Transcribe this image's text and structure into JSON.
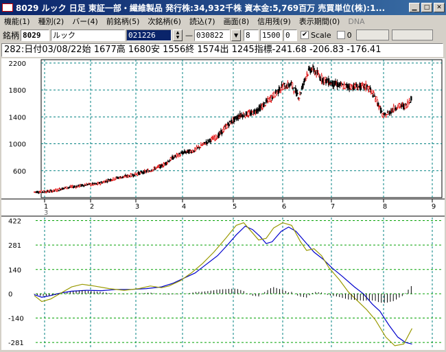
{
  "window": {
    "title": "8029 ルック  日足  東証一部・繊維製品  発行株:34,932千株  資本金:5,769百万  売買単位(株):1..."
  },
  "menu": [
    {
      "label": "機能(1)",
      "disabled": false
    },
    {
      "label": "種別(2)",
      "disabled": false
    },
    {
      "label": "バー(4)",
      "disabled": false
    },
    {
      "label": "前銘柄(5)",
      "disabled": false
    },
    {
      "label": "次銘柄(6)",
      "disabled": false
    },
    {
      "label": "読込(7)",
      "disabled": false
    },
    {
      "label": "画面(8)",
      "disabled": false
    },
    {
      "label": "信用残(9)",
      "disabled": false
    },
    {
      "label": "表示期間(0)",
      "disabled": false
    },
    {
      "label": "DNA",
      "disabled": true
    }
  ],
  "toolbar": {
    "stock_label": "銘柄",
    "code": "8029",
    "name": "ルック",
    "start_date": "021226",
    "dash": "—",
    "end_date": "030822",
    "period": "8",
    "count": "1500",
    "offset": "0",
    "scale_label": "Scale",
    "scale_checked": true,
    "scale_value": "0"
  },
  "info": {
    "text": "282:日付03/08/22始 1677高 1680安 1556終 1574出 1245指標-241.68  -206.83  -176.41"
  },
  "chart_data": [
    {
      "type": "candlestick",
      "ylim": [
        200,
        2250
      ],
      "y_ticks": [
        "2200",
        "1800",
        "1400",
        "1000",
        "600"
      ],
      "y_tick_values": [
        2200,
        1800,
        1400,
        1000,
        600
      ],
      "x_ticks": [
        "1",
        "2",
        "3",
        "4",
        "5",
        "6",
        "7",
        "8",
        "9"
      ],
      "x_sub_label": "3",
      "close_path": [
        [
          0,
          285
        ],
        [
          12,
          290
        ],
        [
          22,
          300
        ],
        [
          35,
          345
        ],
        [
          50,
          370
        ],
        [
          60,
          395
        ],
        [
          72,
          400
        ],
        [
          84,
          455
        ],
        [
          96,
          495
        ],
        [
          108,
          520
        ],
        [
          120,
          560
        ],
        [
          132,
          600
        ],
        [
          148,
          680
        ],
        [
          160,
          800
        ],
        [
          172,
          870
        ],
        [
          184,
          900
        ],
        [
          198,
          1020
        ],
        [
          212,
          1120
        ],
        [
          224,
          1300
        ],
        [
          238,
          1430
        ],
        [
          250,
          1450
        ],
        [
          262,
          1550
        ],
        [
          274,
          1700
        ],
        [
          286,
          1850
        ],
        [
          296,
          1880
        ],
        [
          305,
          1700
        ],
        [
          314,
          2050
        ],
        [
          320,
          2120
        ],
        [
          330,
          1980
        ],
        [
          342,
          1900
        ],
        [
          355,
          1860
        ],
        [
          372,
          1850
        ],
        [
          384,
          1850
        ],
        [
          394,
          1660
        ],
        [
          402,
          1400
        ],
        [
          410,
          1480
        ],
        [
          418,
          1560
        ],
        [
          428,
          1560
        ],
        [
          434,
          1680
        ]
      ],
      "grid": true
    },
    {
      "type": "line",
      "ylim": [
        -320,
        440
      ],
      "y_ticks": [
        "422",
        "281",
        "140",
        "0",
        "-140",
        "-281"
      ],
      "y_tick_values": [
        422,
        281,
        140,
        0,
        -140,
        -281
      ],
      "series": [
        {
          "color": "#0000cc",
          "values": [
            [
              0,
              -5
            ],
            [
              10,
              -20
            ],
            [
              22,
              -10
            ],
            [
              36,
              5
            ],
            [
              50,
              15
            ],
            [
              70,
              20
            ],
            [
              90,
              18
            ],
            [
              110,
              25
            ],
            [
              130,
              25
            ],
            [
              150,
              30
            ],
            [
              170,
              40
            ],
            [
              185,
              60
            ],
            [
              200,
              90
            ],
            [
              215,
              120
            ],
            [
              230,
              170
            ],
            [
              245,
              220
            ],
            [
              258,
              280
            ],
            [
              270,
              340
            ],
            [
              282,
              390
            ],
            [
              292,
              370
            ],
            [
              302,
              330
            ],
            [
              310,
              290
            ],
            [
              318,
              300
            ],
            [
              330,
              360
            ],
            [
              340,
              385
            ],
            [
              350,
              360
            ],
            [
              362,
              300
            ],
            [
              374,
              240
            ],
            [
              386,
              200
            ],
            [
              398,
              150
            ],
            [
              412,
              100
            ],
            [
              428,
              40
            ],
            [
              440,
              0
            ],
            [
              452,
              -60
            ],
            [
              462,
              -100
            ],
            [
              474,
              -180
            ],
            [
              486,
              -250
            ],
            [
              496,
              -280
            ],
            [
              505,
              -290
            ]
          ]
        },
        {
          "color": "#999900",
          "values": [
            [
              0,
              -10
            ],
            [
              10,
              -45
            ],
            [
              22,
              -30
            ],
            [
              36,
              5
            ],
            [
              50,
              40
            ],
            [
              64,
              55
            ],
            [
              80,
              45
            ],
            [
              100,
              30
            ],
            [
              120,
              20
            ],
            [
              140,
              30
            ],
            [
              155,
              45
            ],
            [
              170,
              35
            ],
            [
              180,
              45
            ],
            [
              195,
              75
            ],
            [
              210,
              120
            ],
            [
              225,
              175
            ],
            [
              240,
              240
            ],
            [
              256,
              320
            ],
            [
              270,
              395
            ],
            [
              280,
              410
            ],
            [
              290,
              360
            ],
            [
              300,
              310
            ],
            [
              310,
              320
            ],
            [
              320,
              380
            ],
            [
              332,
              410
            ],
            [
              344,
              395
            ],
            [
              356,
              300
            ],
            [
              364,
              250
            ],
            [
              374,
              260
            ],
            [
              384,
              220
            ],
            [
              394,
              150
            ],
            [
              408,
              80
            ],
            [
              420,
              10
            ],
            [
              432,
              -40
            ],
            [
              444,
              -90
            ],
            [
              456,
              -150
            ],
            [
              470,
              -250
            ],
            [
              482,
              -300
            ],
            [
              494,
              -290
            ],
            [
              505,
              -200
            ]
          ]
        }
      ],
      "histogram_note": "MACD histogram bars around zero line",
      "grid": true
    }
  ],
  "colors": {
    "title_bg": "#0a246a",
    "up_candle": "#e00000",
    "down_candle": "#000000",
    "grid": "#008080",
    "macd_line": "#0000cc",
    "signal_line": "#999900"
  }
}
